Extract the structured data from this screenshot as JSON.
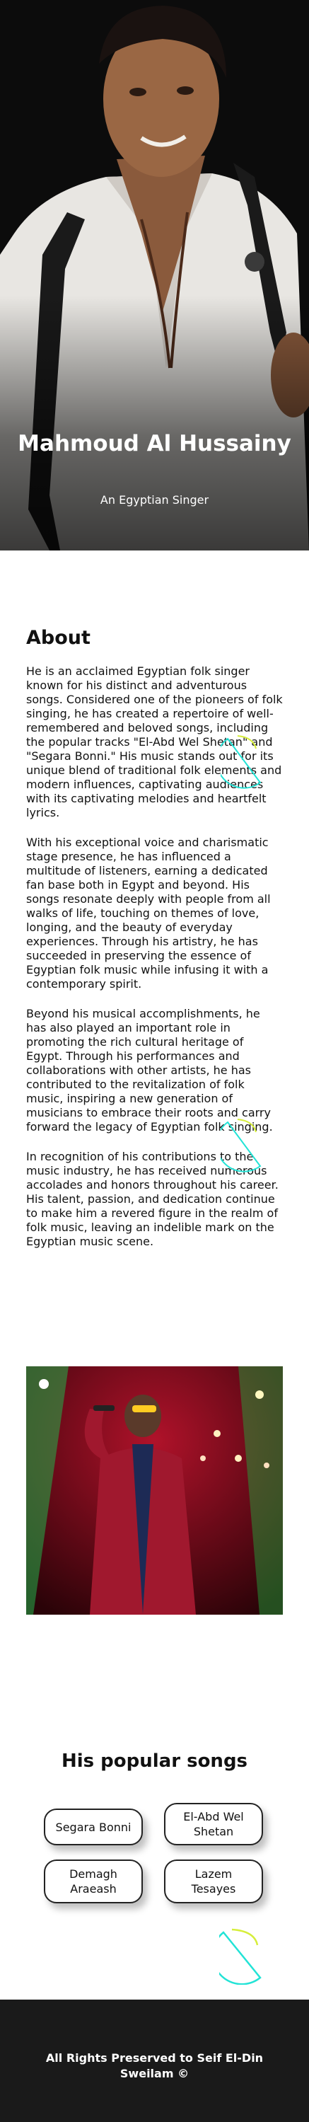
{
  "hero": {
    "title": "Mahmoud Al Hussainy",
    "subtitle": "An Egyptian Singer"
  },
  "about": {
    "heading": "About",
    "paragraphs": [
      "He is an acclaimed Egyptian folk singer known for his distinct and adventurous songs. Considered one of the pioneers of folk singing, he has created a repertoire of well-remembered and beloved songs, including the popular tracks \"El-Abd Wel Shetan\" and \"Segara Bonni.\" His music stands out for its unique blend of traditional folk elements and modern influences, captivating audiences with its captivating melodies and heartfelt lyrics.",
      "With his exceptional voice and charismatic stage presence, he has influenced a multitude of listeners, earning a dedicated fan base both in Egypt and beyond. His songs resonate deeply with people from all walks of life, touching on themes of love, longing, and the beauty of everyday experiences. Through his artistry, he has succeeded in preserving the essence of Egyptian folk music while infusing it with a contemporary spirit.",
      "Beyond his musical accomplishments, he has also played an important role in promoting the rich cultural heritage of Egypt. Through his performances and collaborations with other artists, he has contributed to the revitalization of folk music, inspiring a new generation of musicians to embrace their roots and carry forward the legacy of Egyptian folk singing.",
      "In recognition of his contributions to the music industry, he has received numerous accolades and honors throughout his career. His talent, passion, and dedication continue to make him a revered figure in the realm of folk music, leaving an indelible mark on the Egyptian music scene."
    ]
  },
  "songs": {
    "heading": "His popular songs",
    "items": [
      "Segara Bonni",
      "El-Abd Wel Shetan",
      "Demagh Araeash",
      "Lazem Tesayes"
    ]
  },
  "footer": {
    "text": "All Rights Preserved to Seif El-Din Sweilam ©"
  },
  "colors": {
    "accent": "#22e3d6",
    "accent2": "#d6ee3a",
    "footer_bg": "#1a1a1a"
  }
}
